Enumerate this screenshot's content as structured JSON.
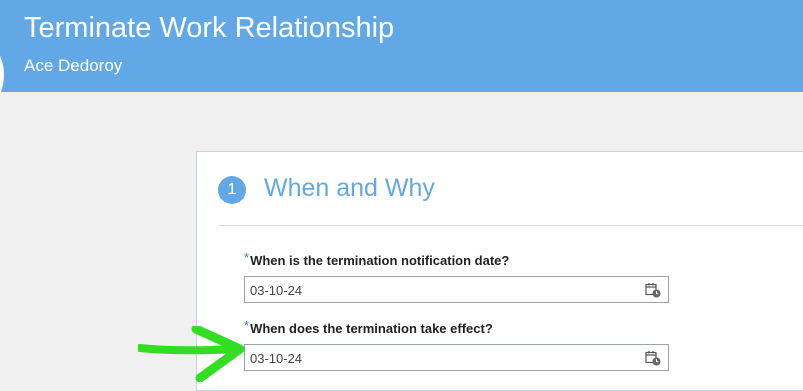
{
  "header": {
    "title": "Terminate Work Relationship",
    "subtitle": "Ace Dedoroy"
  },
  "section": {
    "step_number": "1",
    "title": "When and Why"
  },
  "fields": [
    {
      "required_mark": "*",
      "label": "When is the termination notification date?",
      "value": "03-10-24",
      "icon": "calendar-icon"
    },
    {
      "required_mark": "*",
      "label": "When does the termination take effect?",
      "value": "03-10-24",
      "icon": "calendar-icon"
    }
  ],
  "colors": {
    "header_bg": "#62a8e5",
    "accent": "#62a8e5",
    "required": "#2a7fd4",
    "annotation_arrow": "#33dd22"
  }
}
